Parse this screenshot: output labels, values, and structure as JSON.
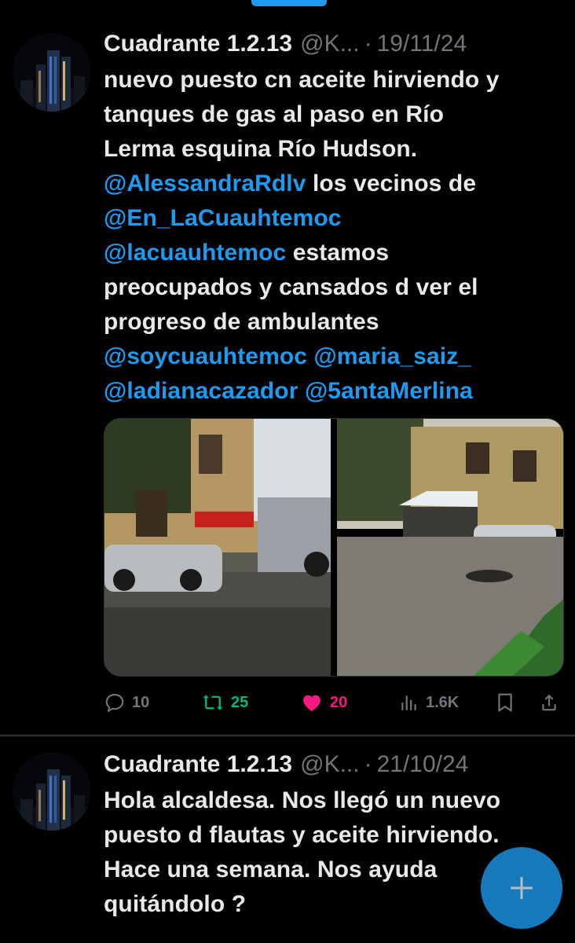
{
  "tweets": [
    {
      "name": "Cuadrante 1.2.13",
      "handle": "@K...",
      "separator": "·",
      "date": "19/11/24",
      "lines": [
        [
          {
            "t": "nuevo puesto cn aceite hirviendo y",
            "m": false
          }
        ],
        [
          {
            "t": "tanques de gas al paso en Río",
            "m": false
          }
        ],
        [
          {
            "t": "Lerma esquina Río Hudson.",
            "m": false
          }
        ],
        [
          {
            "t": "@AlessandraRdlv",
            "m": true
          },
          {
            "t": " los vecinos de",
            "m": false
          }
        ],
        [
          {
            "t": "@En_LaCuauhtemoc",
            "m": true
          }
        ],
        [
          {
            "t": "@lacuauhtemoc",
            "m": true
          },
          {
            "t": " estamos",
            "m": false
          }
        ],
        [
          {
            "t": "preocupados y cansados d ver el",
            "m": false
          }
        ],
        [
          {
            "t": "progreso de ambulantes",
            "m": false
          }
        ],
        [
          {
            "t": "@soycuauhtemoc",
            "m": true
          },
          {
            "t": "  ",
            "m": false
          },
          {
            "t": "@maria_saiz_",
            "m": true
          }
        ],
        [
          {
            "t": "@ladianacazador",
            "m": true
          },
          {
            "t": " ",
            "m": false
          },
          {
            "t": "@5antaMerlina",
            "m": true
          }
        ]
      ],
      "stats": {
        "replies": "10",
        "reposts": "25",
        "likes": "20",
        "views": "1.6K"
      },
      "colors": {
        "repost": "#00ba7c",
        "like": "#f91880",
        "muted": "#71767b",
        "link": "#1d9bf0"
      }
    },
    {
      "name": "Cuadrante 1.2.13",
      "handle": "@K...",
      "separator": "·",
      "date": "21/10/24",
      "lines": [
        [
          {
            "t": "Hola alcaldesa. Nos llegó un nuevo",
            "m": false
          }
        ],
        [
          {
            "t": "puesto d flautas y aceite hirviendo.",
            "m": false
          }
        ],
        [
          {
            "t": "Hace una semana. Nos ayuda",
            "m": false
          }
        ],
        [
          {
            "t": "quitándolo ?",
            "m": false
          }
        ]
      ]
    }
  ],
  "fab": {
    "icon": "plus-icon",
    "color": "#1d9bf0"
  }
}
